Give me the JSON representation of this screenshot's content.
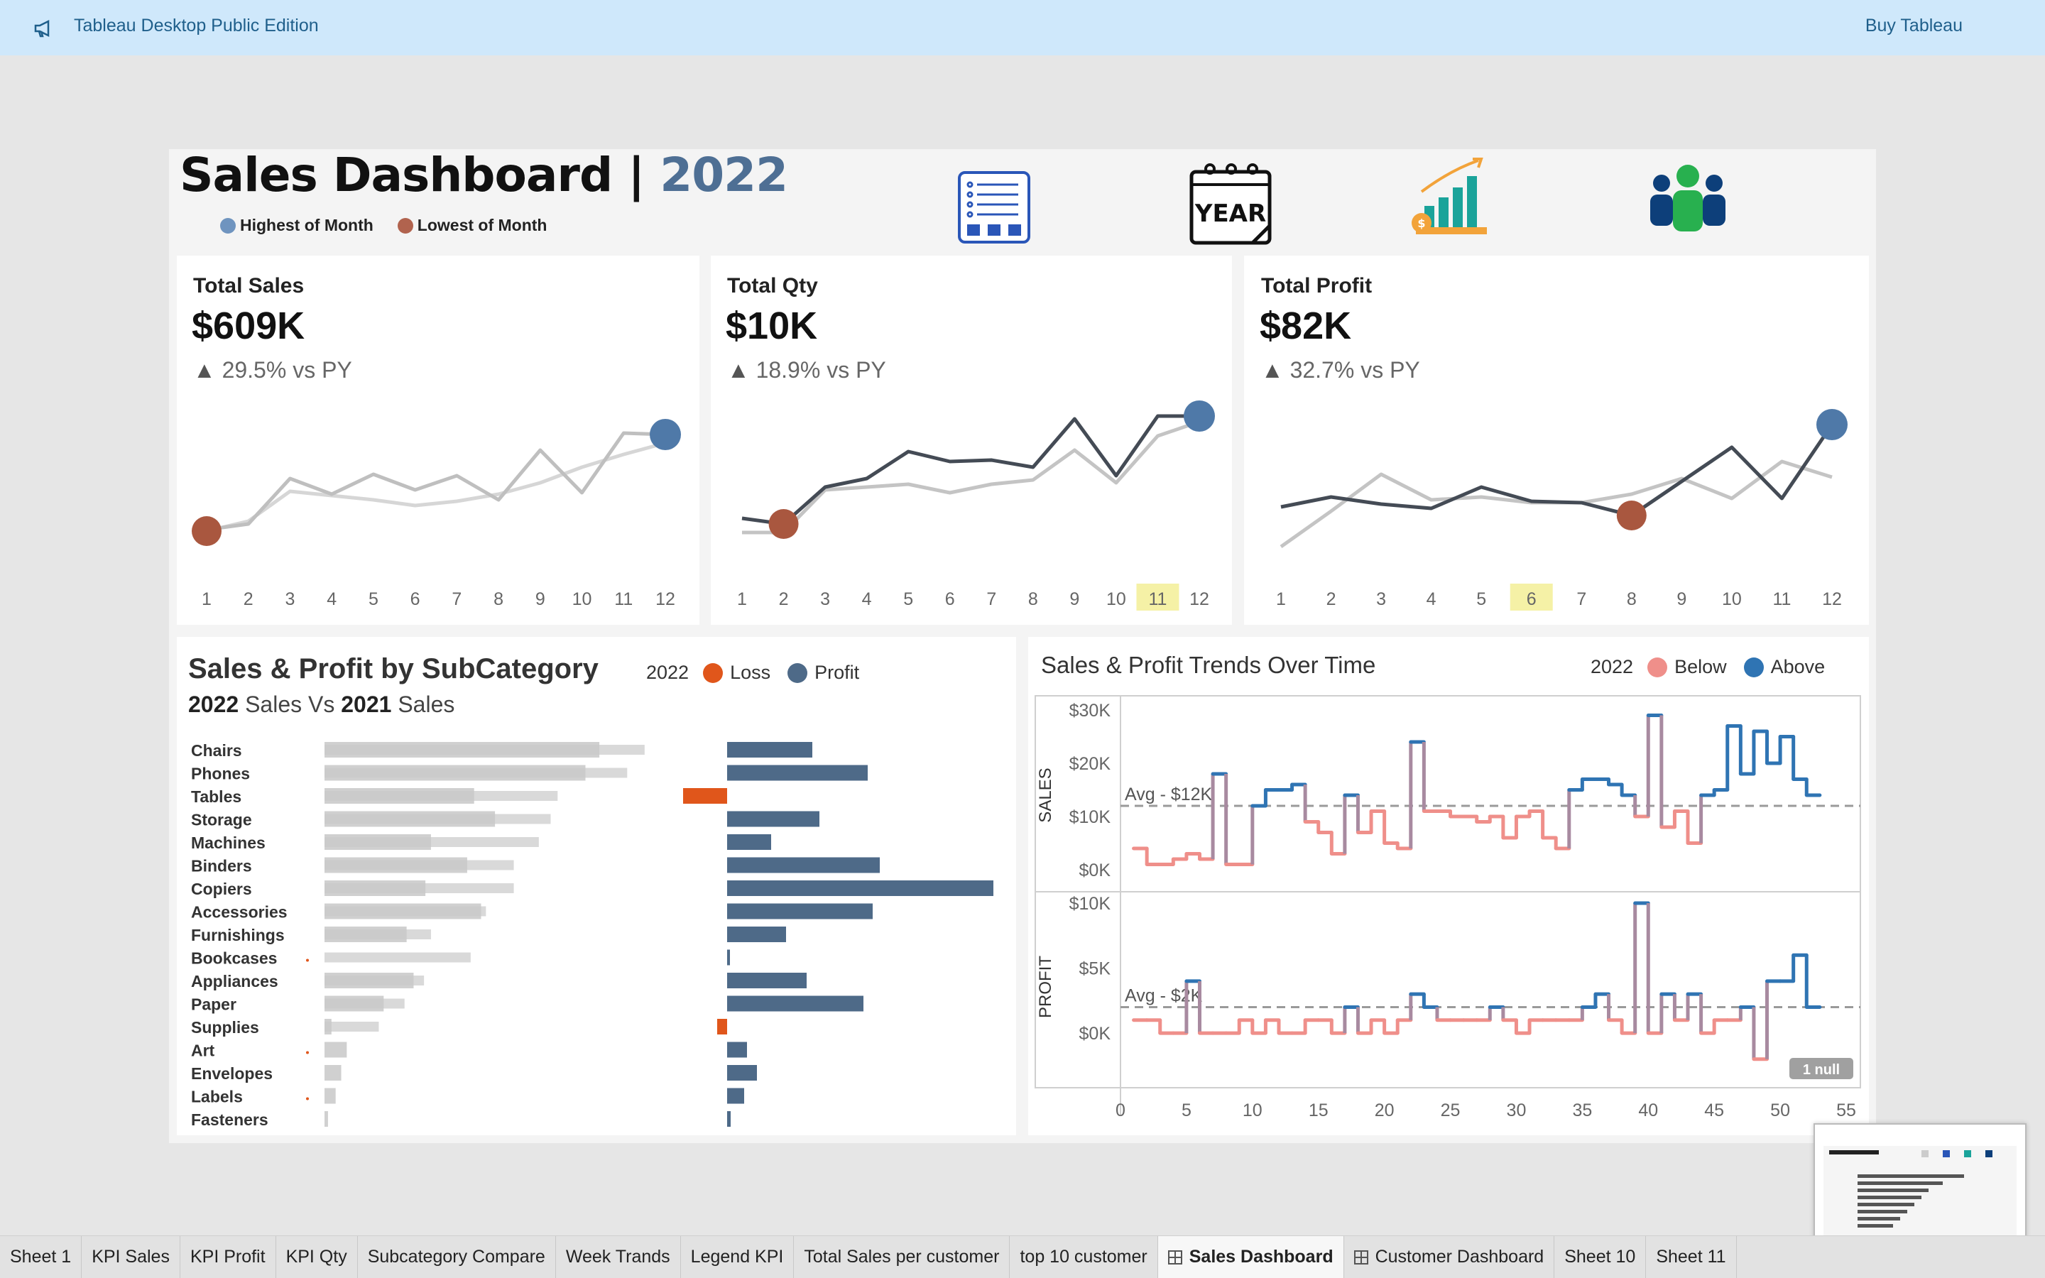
{
  "banner": {
    "title": "Tableau Desktop Public Edition",
    "buy": "Buy Tableau"
  },
  "header": {
    "title": "Sales Dashboard | ",
    "year": "2022",
    "legend": [
      {
        "label": "Highest of Month",
        "color": "#6f94bf"
      },
      {
        "label": "Lowest of Month",
        "color": "#b1634e"
      }
    ],
    "icons": [
      "checklist-icon",
      "year-calendar-icon",
      "growth-chart-icon",
      "customers-icon"
    ],
    "icon_year_text": "YEAR"
  },
  "kpis": [
    {
      "label": "Total Sales",
      "value": "$609K",
      "delta": "29.5% vs PY"
    },
    {
      "label": "Total Qty",
      "value": "$10K",
      "delta": "18.9% vs PY"
    },
    {
      "label": "Total Profit",
      "value": "$82K",
      "delta": "32.7% vs PY"
    }
  ],
  "subcategory": {
    "title": "Sales & Profit by SubCategory",
    "subtitle_a": "2022",
    "subtitle_b": " Sales  Vs ",
    "subtitle_c": "2021",
    "subtitle_d": " Sales",
    "legend_year": "2022",
    "legend": [
      {
        "label": "Loss",
        "color": "#e0561b"
      },
      {
        "label": "Profit",
        "color": "#4e6a88"
      }
    ]
  },
  "trends": {
    "title": "Sales & Profit Trends Over Time",
    "legend_year": "2022",
    "legend": [
      {
        "label": "Below",
        "color": "#ef8f8a"
      },
      {
        "label": "Above",
        "color": "#2f74b3"
      }
    ],
    "sales_axis_title": "SALES",
    "profit_axis_title": "PROFIT",
    "sales_ticks": [
      "$30K",
      "$20K",
      "$10K",
      "$0K"
    ],
    "profit_ticks": [
      "$10K",
      "$5K",
      "$0K"
    ],
    "sales_avg": "Avg - $12K",
    "profit_avg": "Avg - $2K",
    "x_ticks": [
      "0",
      "5",
      "10",
      "15",
      "20",
      "25",
      "30",
      "35",
      "40",
      "45",
      "50",
      "55"
    ],
    "null_badge": "1 null"
  },
  "tabs": [
    {
      "label": "Sheet 1"
    },
    {
      "label": "KPI Sales"
    },
    {
      "label": "KPI Profit"
    },
    {
      "label": "KPI Qty"
    },
    {
      "label": "Subcategory Compare"
    },
    {
      "label": "Week Trands"
    },
    {
      "label": "Legend KPI"
    },
    {
      "label": "Total Sales per customer"
    },
    {
      "label": "top 10 customer"
    },
    {
      "label": "Sales Dashboard",
      "active": true,
      "grid": true
    },
    {
      "label": "Customer Dashboard",
      "grid": true
    },
    {
      "label": "Sheet 10"
    },
    {
      "label": "Sheet 11"
    }
  ],
  "chart_data": [
    {
      "type": "line",
      "title": "Total Sales",
      "x": [
        1,
        2,
        3,
        4,
        5,
        6,
        7,
        8,
        9,
        10,
        11,
        12
      ],
      "series": [
        {
          "values": [
            22,
            26,
            58,
            47,
            61,
            50,
            60,
            43,
            78,
            48,
            90,
            89
          ]
        },
        {
          "values": [
            21,
            28,
            49,
            46,
            43,
            39,
            42,
            47,
            55,
            66,
            75,
            83
          ]
        }
      ],
      "highlight_low": {
        "x": 1
      },
      "highlight_high": {
        "x": 12
      }
    },
    {
      "type": "line",
      "title": "Total Qty",
      "x": [
        1,
        2,
        3,
        4,
        5,
        6,
        7,
        8,
        9,
        10,
        11,
        12
      ],
      "series": [
        {
          "values": [
            30,
            26,
            52,
            58,
            77,
            70,
            71,
            66,
            100,
            60,
            102,
            102
          ]
        },
        {
          "values": [
            20,
            20,
            50,
            52,
            54,
            48,
            54,
            57,
            78,
            55,
            88,
            98
          ]
        }
      ],
      "highlight_low": {
        "x": 2
      },
      "highlight_high": {
        "x": 12
      },
      "highlight_tick": "11"
    },
    {
      "type": "line",
      "title": "Total Profit",
      "x": [
        1,
        2,
        3,
        4,
        5,
        6,
        7,
        8,
        9,
        10,
        11,
        12
      ],
      "series": [
        {
          "values": [
            38,
            45,
            40,
            37,
            52,
            42,
            41,
            32,
            56,
            80,
            44,
            96
          ]
        },
        {
          "values": [
            10,
            35,
            61,
            43,
            45,
            41,
            41,
            47,
            58,
            44,
            70,
            59
          ]
        }
      ],
      "highlight_low": {
        "x": 8
      },
      "highlight_high": {
        "x": 12
      },
      "highlight_tick": "6"
    },
    {
      "type": "bar",
      "title": "Sales & Profit by SubCategory",
      "categories": [
        "Chairs",
        "Phones",
        "Tables",
        "Storage",
        "Machines",
        "Binders",
        "Copiers",
        "Accessories",
        "Furnishings",
        "Bookcases",
        "Appliances",
        "Paper",
        "Supplies",
        "Art",
        "Envelopes",
        "Labels",
        "Fasteners"
      ],
      "series": [
        {
          "name": "2022",
          "values": [
            395,
            375,
            215,
            245,
            153,
            205,
            145,
            225,
            118,
            0,
            128,
            85,
            10,
            32,
            24,
            16,
            5
          ]
        },
        {
          "name": "2021",
          "values": [
            460,
            435,
            335,
            325,
            308,
            272,
            272,
            232,
            153,
            210,
            143,
            115,
            78,
            0,
            0,
            0,
            0
          ]
        },
        {
          "name": "Profit",
          "values": [
            120,
            198,
            -62,
            130,
            62,
            215,
            375,
            205,
            83,
            4,
            112,
            192,
            -14,
            28,
            42,
            24,
            5
          ]
        }
      ]
    },
    {
      "type": "line",
      "title": "Sales & Profit Trends Over Time",
      "xlim": [
        0,
        55
      ],
      "series": [
        {
          "name": "SALES",
          "values": [
            4,
            1,
            1,
            2,
            3,
            2,
            18,
            1,
            1,
            12,
            15,
            15,
            16,
            9,
            7,
            3,
            14,
            7,
            11,
            5,
            4,
            24,
            11,
            11,
            10,
            10,
            9,
            10,
            6,
            10,
            11,
            6,
            4,
            15,
            17,
            17,
            16,
            14,
            10,
            29,
            8,
            11,
            5,
            14,
            15,
            27,
            18,
            26,
            20,
            25,
            17,
            14
          ],
          "avg": 12
        },
        {
          "name": "PROFIT",
          "values": [
            1,
            1,
            0,
            0,
            4,
            0,
            0,
            0,
            1,
            0,
            1,
            0,
            0,
            1,
            1,
            0,
            2,
            0,
            1,
            0,
            1,
            3,
            2,
            1,
            1,
            1,
            1,
            2,
            1,
            0,
            1,
            1,
            1,
            1,
            2,
            3,
            1,
            0,
            10,
            0,
            3,
            1,
            3,
            0,
            1,
            1,
            2,
            -2,
            4,
            4,
            6,
            2
          ],
          "avg": 2
        }
      ]
    }
  ]
}
